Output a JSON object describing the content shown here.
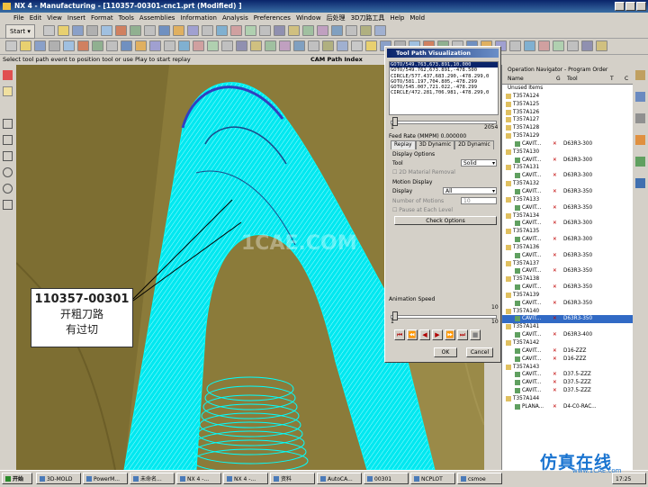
{
  "window": {
    "title": "NX 4 - Manufacturing - [110357-00301-cnc1.prt (Modified) ]"
  },
  "menu": [
    "File",
    "Edit",
    "View",
    "Insert",
    "Format",
    "Tools",
    "Assemblies",
    "Information",
    "Analysis",
    "Preferences",
    "Window",
    "后处理",
    "3D刀路工具",
    "Help",
    "Mold"
  ],
  "toolbar": {
    "start_label": "Start"
  },
  "status": {
    "cue": "Select tool path event to position tool or use Play to start replay",
    "panel_label": "CAM Path Index"
  },
  "dialog": {
    "title": "Tool Path Visualization",
    "path_lines": [
      "GOTO/549.763,673.891,10.000",
      "GOTO/549.762,673.891,-478.500",
      "CIRCLE/577.437,683.290,-478.299,0",
      "GOTO/581.197,704.805,-478.299",
      "GOTO/545.007,721.022,-478.299",
      "CIRCLE/472.281,706.981,-478.299,0"
    ],
    "slider_min": "1",
    "slider_max": "2054",
    "feed_rate_label": "Feed Rate (MMPM) 0.000000",
    "tabs": [
      "Replay",
      "3D Dynamic",
      "2D Dynamic"
    ],
    "display_options_label": "Display Options",
    "tool_label": "Tool",
    "tool_value": "Solid",
    "material_removal_label": "2D Material Removal",
    "motion_display_label": "Motion Display",
    "display_label": "Display",
    "display_value": "All",
    "number_of_motions_label": "Number of Motions",
    "number_of_motions_value": "10",
    "pause_label": "Pause at Each Level",
    "check_options_label": "Check Options",
    "animation_speed_label": "Animation Speed",
    "speed_max": "10",
    "speed_min": "1",
    "ok_label": "OK",
    "cancel_label": "Cancel"
  },
  "navigator": {
    "title": "Operation Navigator - Program Order",
    "columns": {
      "name": "Name",
      "path": "G",
      "tool": "Tool",
      "t": "T",
      "extra": "C"
    },
    "header_row": "Unused Items",
    "rows": [
      {
        "name": "T357A124",
        "tool": "",
        "state": "group"
      },
      {
        "name": "T357A125",
        "tool": "",
        "state": "group"
      },
      {
        "name": "T357A126",
        "tool": "",
        "state": "group"
      },
      {
        "name": "T357A127",
        "tool": "",
        "state": "group"
      },
      {
        "name": "T357A128",
        "tool": "",
        "state": "group"
      },
      {
        "name": "T357A129",
        "tool": "",
        "state": "group"
      },
      {
        "name": "CAVIT...",
        "tool": "D63R3-300",
        "state": "op"
      },
      {
        "name": "T357A130",
        "tool": "",
        "state": "group"
      },
      {
        "name": "CAVIT...",
        "tool": "D63R3-300",
        "state": "op"
      },
      {
        "name": "T357A131",
        "tool": "",
        "state": "group"
      },
      {
        "name": "CAVIT...",
        "tool": "D63R3-300",
        "state": "op"
      },
      {
        "name": "T357A132",
        "tool": "",
        "state": "group"
      },
      {
        "name": "CAVIT...",
        "tool": "D63R3-350",
        "state": "op"
      },
      {
        "name": "T357A133",
        "tool": "",
        "state": "group"
      },
      {
        "name": "CAVIT...",
        "tool": "D63R3-350",
        "state": "op"
      },
      {
        "name": "T357A134",
        "tool": "",
        "state": "group"
      },
      {
        "name": "CAVIT...",
        "tool": "D63R3-300",
        "state": "op"
      },
      {
        "name": "T357A135",
        "tool": "",
        "state": "group"
      },
      {
        "name": "CAVIT...",
        "tool": "D63R3-300",
        "state": "op"
      },
      {
        "name": "T357A136",
        "tool": "",
        "state": "group"
      },
      {
        "name": "CAVIT...",
        "tool": "D63R3-350",
        "state": "op"
      },
      {
        "name": "T357A137",
        "tool": "",
        "state": "group"
      },
      {
        "name": "CAVIT...",
        "tool": "D63R3-350",
        "state": "op"
      },
      {
        "name": "T357A138",
        "tool": "",
        "state": "group"
      },
      {
        "name": "CAVIT...",
        "tool": "D63R3-350",
        "state": "op"
      },
      {
        "name": "T357A139",
        "tool": "",
        "state": "group"
      },
      {
        "name": "CAVIT...",
        "tool": "D63R3-350",
        "state": "op"
      },
      {
        "name": "T357A140",
        "tool": "",
        "state": "group"
      },
      {
        "name": "CAVIT...",
        "tool": "D63R3-350",
        "state": "selected"
      },
      {
        "name": "T357A141",
        "tool": "",
        "state": "group"
      },
      {
        "name": "CAVIT...",
        "tool": "D63R3-400",
        "state": "op"
      },
      {
        "name": "T357A142",
        "tool": "",
        "state": "group"
      },
      {
        "name": "CAVIT...",
        "tool": "D16-ZZZ",
        "state": "op"
      },
      {
        "name": "CAVIT...",
        "tool": "D16-ZZZ",
        "state": "op"
      },
      {
        "name": "T357A143",
        "tool": "",
        "state": "group"
      },
      {
        "name": "CAVIT...",
        "tool": "D37.5-ZZZ",
        "state": "op"
      },
      {
        "name": "CAVIT...",
        "tool": "D37.5-ZZZ",
        "state": "op"
      },
      {
        "name": "CAVIT...",
        "tool": "D37.5-ZZZ",
        "state": "op"
      },
      {
        "name": "T357A144",
        "tool": "",
        "state": "group"
      },
      {
        "name": "PLANA...",
        "tool": "D4-C0-RAC...",
        "state": "op"
      }
    ]
  },
  "callout": {
    "line1": "110357-00301",
    "line2": "开粗刀路",
    "line3": "有过切"
  },
  "watermark": "1CAE.COM",
  "taskbar": {
    "start": "开始",
    "items": [
      "3D-MOLD",
      "PowerM...",
      "未命名...",
      "NX 4 -...",
      "NX 4 -...",
      "资料",
      "AutoCA...",
      "00301",
      "NCPLOT",
      "csmoe"
    ],
    "clock": "17:25"
  },
  "logo": {
    "text": "仿真在线",
    "url": "www.1CAE.com"
  },
  "colors": {
    "toolpath": "#00f0f0",
    "part": "#8a7a3a",
    "selected_row": "#316ac5",
    "title_blue": "#0a246a"
  }
}
